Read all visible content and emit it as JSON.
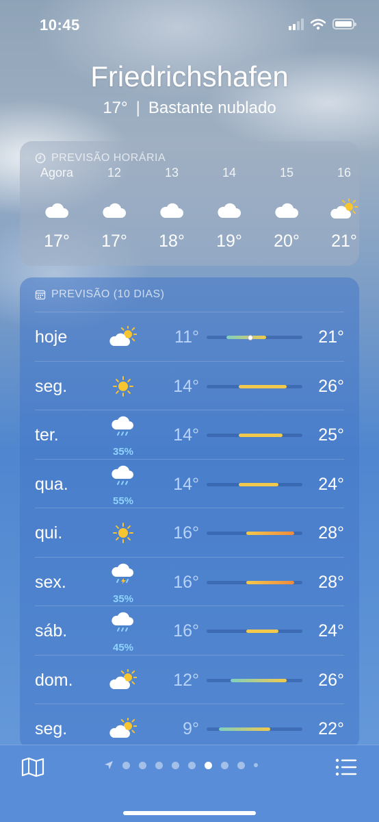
{
  "status_bar": {
    "time": "10:45"
  },
  "location": {
    "city": "Friedrichshafen",
    "temperature": "17°",
    "separator": "|",
    "condition": "Bastante nublado"
  },
  "hourly": {
    "header": "PREVISÃO HORÁRIA",
    "items": [
      {
        "label": "Agora",
        "icon": "cloud-icon",
        "temp": "17°"
      },
      {
        "label": "12",
        "icon": "cloud-icon",
        "temp": "17°"
      },
      {
        "label": "13",
        "icon": "cloud-icon",
        "temp": "18°"
      },
      {
        "label": "14",
        "icon": "cloud-icon",
        "temp": "19°"
      },
      {
        "label": "15",
        "icon": "cloud-icon",
        "temp": "20°"
      },
      {
        "label": "16",
        "icon": "partly-sunny-icon",
        "temp": "21°"
      }
    ]
  },
  "daily": {
    "header": "PREVISÃO (10 DIAS)",
    "days": [
      {
        "day": "hoje",
        "icon": "partly-sunny-icon",
        "precip": "",
        "low": "11°",
        "high": "21°",
        "range": [
          11,
          21
        ],
        "current": 17
      },
      {
        "day": "seg.",
        "icon": "sun-icon",
        "precip": "",
        "low": "14°",
        "high": "26°",
        "range": [
          14,
          26
        ]
      },
      {
        "day": "ter.",
        "icon": "rain-cloud-icon",
        "precip": "35%",
        "low": "14°",
        "high": "25°",
        "range": [
          14,
          25
        ]
      },
      {
        "day": "qua.",
        "icon": "rain-cloud-icon",
        "precip": "55%",
        "low": "14°",
        "high": "24°",
        "range": [
          14,
          24
        ]
      },
      {
        "day": "qui.",
        "icon": "sun-icon",
        "precip": "",
        "low": "16°",
        "high": "28°",
        "range": [
          16,
          28
        ]
      },
      {
        "day": "sex.",
        "icon": "thunderstorm-icon",
        "precip": "35%",
        "low": "16°",
        "high": "28°",
        "range": [
          16,
          28
        ]
      },
      {
        "day": "sáb.",
        "icon": "rain-cloud-icon",
        "precip": "45%",
        "low": "16°",
        "high": "24°",
        "range": [
          16,
          24
        ]
      },
      {
        "day": "dom.",
        "icon": "partly-sunny-icon",
        "precip": "",
        "low": "12°",
        "high": "26°",
        "range": [
          12,
          26
        ]
      },
      {
        "day": "seg.",
        "icon": "partly-sunny-icon",
        "precip": "",
        "low": "9°",
        "high": "22°",
        "range": [
          9,
          22
        ]
      }
    ],
    "scale": [
      6,
      30
    ]
  },
  "bottom_bar": {
    "page_count": 10,
    "active_page": 6
  },
  "colors": {
    "sun": "#f7c530",
    "precip": "#8fd3ff",
    "bar_cool": "#7fd0c0",
    "bar_warm": "#f2c94c",
    "bar_hot": "#f08a3c"
  }
}
